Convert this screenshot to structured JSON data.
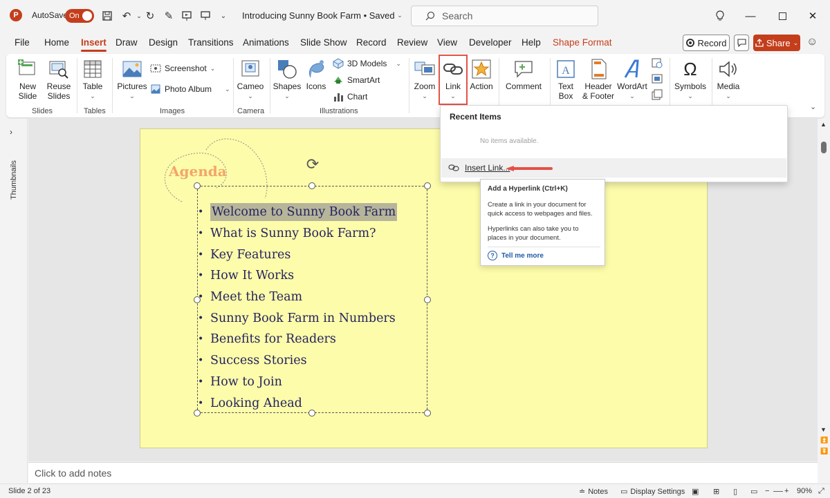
{
  "app": {
    "logo_letter": "P",
    "accent": "#c43e1c"
  },
  "titlebar": {
    "autosave_label": "AutoSave",
    "autosave_state": "On",
    "doc_title": "Introducing Sunny Book Farm • Saved",
    "search_placeholder": "Search"
  },
  "tabs": [
    "File",
    "Home",
    "Insert",
    "Draw",
    "Design",
    "Transitions",
    "Animations",
    "Slide Show",
    "Record",
    "Review",
    "View",
    "Developer",
    "Help",
    "Shape Format"
  ],
  "active_tab": "Insert",
  "right_buttons": {
    "record": "Record",
    "share": "Share"
  },
  "ribbon": {
    "new_slide": "New Slide",
    "reuse_slides": "Reuse Slides",
    "table": "Table",
    "pictures": "Pictures",
    "screenshot": "Screenshot",
    "photo_album": "Photo Album",
    "cameo": "Cameo",
    "shapes": "Shapes",
    "icons": "Icons",
    "models_3d": "3D Models",
    "smartart": "SmartArt",
    "chart": "Chart",
    "zoom": "Zoom",
    "link": "Link",
    "action": "Action",
    "comment": "Comment",
    "text_box": "Text Box",
    "header_footer": "Header & Footer",
    "wordart": "WordArt",
    "symbols": "Symbols",
    "media": "Media",
    "groups": {
      "slides": "Slides",
      "tables": "Tables",
      "images": "Images",
      "camera": "Camera",
      "illustrations": "Illustrations"
    }
  },
  "thumbnails_label": "Thumbnails",
  "slide": {
    "title": "Agenda",
    "items": [
      "Welcome to Sunny Book Farm",
      "What is Sunny Book Farm?",
      "Key Features",
      "How It Works",
      "Meet the Team",
      "Sunny Book Farm in Numbers",
      "Benefits for Readers",
      "Success Stories",
      "How to Join",
      "Looking Ahead"
    ],
    "selected_index": 0
  },
  "link_dropdown": {
    "header": "Recent Items",
    "empty": "No items available.",
    "insert_link": "Insert Link..."
  },
  "tooltip": {
    "title": "Add a Hyperlink (Ctrl+K)",
    "p1": "Create a link in your document for quick access to webpages and files.",
    "p2": "Hyperlinks can also take you to places in your document.",
    "more": "Tell me more"
  },
  "notes_placeholder": "Click to add notes",
  "status": {
    "slide": "Slide 2 of 23",
    "notes": "Notes",
    "display_settings": "Display Settings",
    "zoom": "90%"
  }
}
